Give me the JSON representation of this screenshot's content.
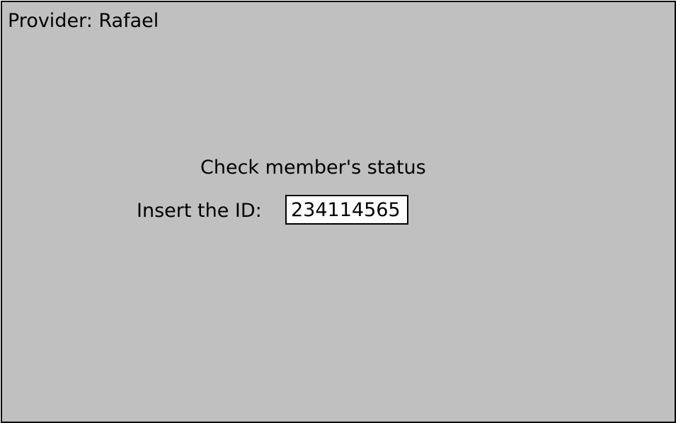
{
  "header": {
    "provider_text": "Provider: Rafael"
  },
  "form": {
    "title": "Check member's status",
    "id_label": "Insert the ID:",
    "id_value": "234114565"
  },
  "colors": {
    "panel_background": "#c0c0c0",
    "border": "#000000",
    "input_background": "#ffffff",
    "text": "#000000"
  }
}
